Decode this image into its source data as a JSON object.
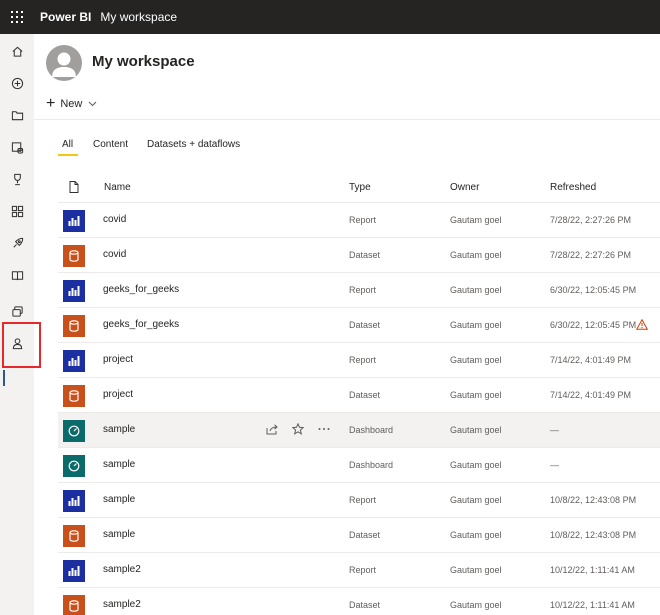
{
  "topbar": {
    "app_name": "Power BI",
    "breadcrumb": "My workspace"
  },
  "nav_rail": {
    "items": [
      "home-icon",
      "create-icon",
      "browse-icon",
      "data-hub-icon",
      "metrics-icon",
      "apps-icon",
      "deployment-pipelines-icon",
      "learn-icon",
      "workspaces-icon",
      "my-workspace-icon"
    ]
  },
  "workspace": {
    "title": "My workspace",
    "new_label": "New"
  },
  "tabs": [
    "All",
    "Content",
    "Datasets + dataflows"
  ],
  "table": {
    "columns": [
      "Name",
      "Type",
      "Owner",
      "Refreshed"
    ],
    "rows": [
      {
        "name": "covid",
        "type": "Report",
        "owner": "Gautam goel",
        "refreshed": "7/28/22, 2:27:26 PM"
      },
      {
        "name": "covid",
        "type": "Dataset",
        "owner": "Gautam goel",
        "refreshed": "7/28/22, 2:27:26 PM"
      },
      {
        "name": "geeks_for_geeks",
        "type": "Report",
        "owner": "Gautam goel",
        "refreshed": "6/30/22, 12:05:45 PM"
      },
      {
        "name": "geeks_for_geeks",
        "type": "Dataset",
        "owner": "Gautam goel",
        "refreshed": "6/30/22, 12:05:45 PM"
      },
      {
        "name": "project",
        "type": "Report",
        "owner": "Gautam goel",
        "refreshed": "7/14/22, 4:01:49 PM"
      },
      {
        "name": "project",
        "type": "Dataset",
        "owner": "Gautam goel",
        "refreshed": "7/14/22, 4:01:49 PM"
      },
      {
        "name": "sample",
        "type": "Dashboard",
        "owner": "Gautam goel",
        "refreshed": "—"
      },
      {
        "name": "sample",
        "type": "Dashboard",
        "owner": "Gautam goel",
        "refreshed": "—"
      },
      {
        "name": "sample",
        "type": "Report",
        "owner": "Gautam goel",
        "refreshed": "10/8/22, 12:43:08 PM"
      },
      {
        "name": "sample",
        "type": "Dataset",
        "owner": "Gautam goel",
        "refreshed": "10/8/22, 12:43:08 PM"
      },
      {
        "name": "sample2",
        "type": "Report",
        "owner": "Gautam goel",
        "refreshed": "10/12/22, 1:11:41 AM"
      },
      {
        "name": "sample2",
        "type": "Dataset",
        "owner": "Gautam goel",
        "refreshed": "10/12/22, 1:11:41 AM"
      }
    ]
  },
  "colors": {
    "topbar": "#252423",
    "report_icon": "#1c2fa0",
    "dataset_icon": "#c8511b",
    "dashboard_icon": "#0b6a6a",
    "tab_accent": "#f2c811",
    "highlight_box": "#e8282b",
    "warning": "#d83b01"
  }
}
